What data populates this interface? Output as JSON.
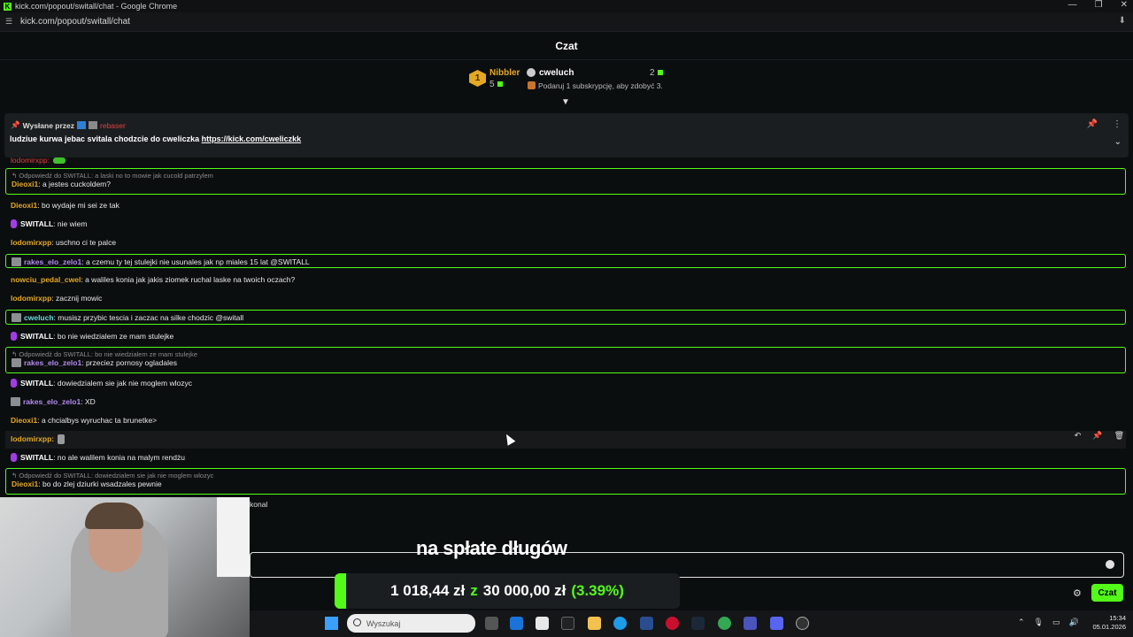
{
  "window": {
    "title": "kick.com/popout/switall/chat - Google Chrome",
    "controls": [
      "—",
      "❐",
      "✕"
    ]
  },
  "address_bar": {
    "url": "kick.com/popout/switall/chat"
  },
  "chat_header": {
    "title": "Czat"
  },
  "leaderboard": {
    "rank": "1",
    "top_name": "Nibbler",
    "top_count": "5",
    "user": "cweluch",
    "user_count": "2",
    "sub_hint": "Podaruj 1 subskrypcję, aby zdobyć 3."
  },
  "pinned": {
    "label": "Wysłane przez",
    "author": "rebaser",
    "message": "ludziue kurwa jebac svitala chodzcie do cweliczka ",
    "link": "https://kick.com/cweliczkk"
  },
  "cutoff_name": "lodomirxpp:",
  "messages": [
    {
      "reply": "Odpowiedź do SWITALL: a laski no to mowie jak cucold patrzylem",
      "user": "Dieoxi1",
      "text": ": a jestes cuckoldem?"
    },
    {
      "user": "Dieoxi1",
      "text": ": bo wydaje mi sei ze tak"
    },
    {
      "user": "SWITALL",
      "text": ": nie wiem"
    },
    {
      "user": "lodomirxpp",
      "text": ": uschno ci te palce"
    },
    {
      "user": "rakes_elo_zelo1",
      "text": ": a czemu ty tej stulejki nie usunales jak np miales 15 lat @SWITALL"
    },
    {
      "user": "nowciu_pedal_cwel",
      "text": ": a waliles konia jak jakis ziomek ruchal laske na twoich oczach?"
    },
    {
      "user": "lodomirxpp",
      "text": ": zacznij mowic"
    },
    {
      "user": "cweluch",
      "text": ": musisz przybic tescia i zaczac na silke chodzic @switall"
    },
    {
      "user": "SWITALL",
      "text": ": bo nie wiedzialem ze mam stulejke"
    },
    {
      "reply": "Odpowiedź do SWITALL: bo nie wiedzialem ze mam stulejke",
      "user": "rakes_elo_zelo1",
      "text": ": przeciez pornosy ogladales"
    },
    {
      "user": "SWITALL",
      "text": ": dowiedzialem sie jak nie moglem wlozyc"
    },
    {
      "user": "rakes_elo_zelo1",
      "text": ": XD"
    },
    {
      "user": "Dieoxi1",
      "text": ": a chcialbys wyruchac ta brunetke>"
    },
    {
      "user": "lodomirxpp:",
      "text": ""
    },
    {
      "user": "SWITALL",
      "text": ": no ale walilem konia na malym rendżu"
    },
    {
      "reply": "Odpowiedź do SWITALL: dowiedzialem sie jak nie moglem wlozyc",
      "user": "Dieoxi1",
      "text": ": bo do zlej dziurki wsadzales pewnie"
    }
  ],
  "partial_text": "konal",
  "overlay": {
    "donation_caption": "na spłate długów",
    "goal_current": "1 018,44 zł",
    "goal_sep": "z",
    "goal_target": "30 000,00 zł",
    "goal_pct": "(3.39%)",
    "goal_fraction": 0.0339
  },
  "input": {
    "send_label": "Czat"
  },
  "taskbar": {
    "search_placeholder": "Wyszukaj",
    "time": "15:34",
    "date": "05.01.2026"
  },
  "colors": {
    "accent": "#53fc18",
    "mention_border": "#53fc18",
    "switall_mic": "#a33ce8",
    "gold": "#e5a823"
  }
}
